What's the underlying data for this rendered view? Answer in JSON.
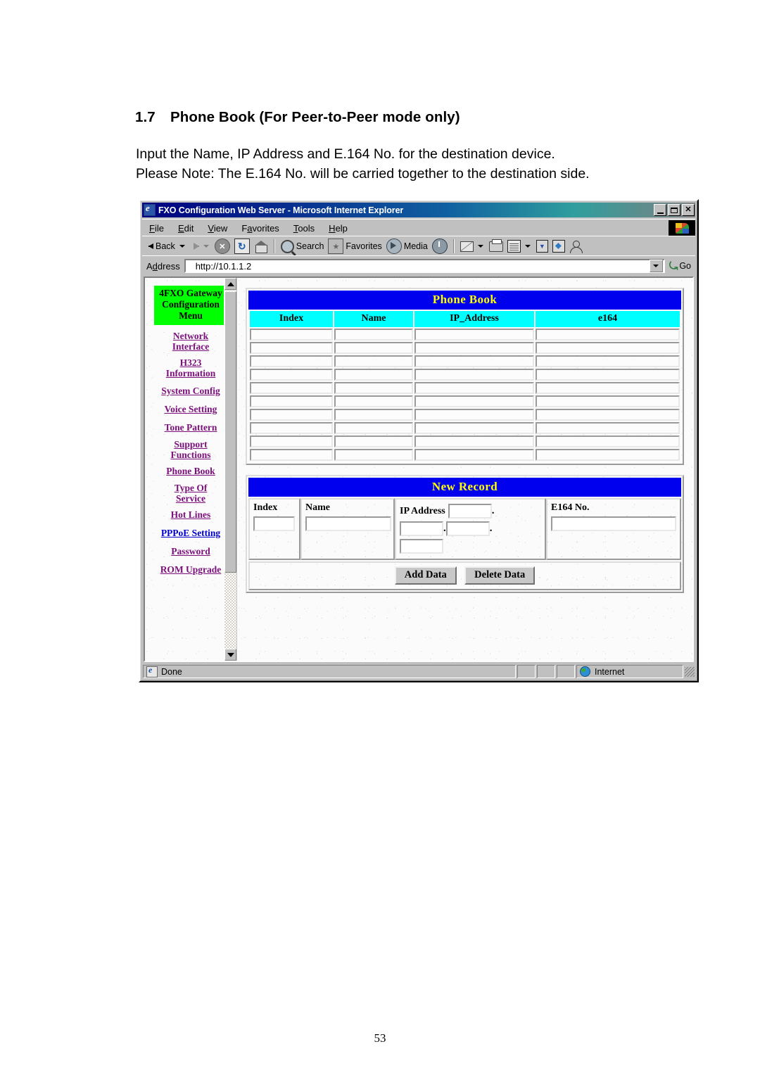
{
  "document": {
    "section_number": "1.7",
    "heading": "Phone Book (For Peer-to-Peer mode only)",
    "paragraph_line1": "Input the Name, IP Address and E.164 No. for the destination device.",
    "paragraph_line2": "Please Note: The E.164 No. will be carried together to the destination side.",
    "page_number": "53"
  },
  "browser": {
    "title": "FXO Configuration Web Server - Microsoft Internet Explorer",
    "window_buttons": {
      "minimize": "_",
      "maximize": "□",
      "close": "✕"
    },
    "menu": [
      {
        "label": "File",
        "accel": "F"
      },
      {
        "label": "Edit",
        "accel": "E"
      },
      {
        "label": "View",
        "accel": "V"
      },
      {
        "label": "Favorites",
        "accel": "a"
      },
      {
        "label": "Tools",
        "accel": "T"
      },
      {
        "label": "Help",
        "accel": "H"
      }
    ],
    "toolbar": {
      "back": "Back",
      "search": "Search",
      "favorites": "Favorites",
      "media": "Media",
      "icons": [
        "back-icon",
        "forward-icon",
        "stop-icon",
        "refresh-icon",
        "home-icon",
        "search-icon",
        "favorites-icon",
        "media-icon",
        "history-icon",
        "mail-icon",
        "print-icon",
        "edit-icon",
        "discuss-icon",
        "messenger-icon",
        "person-icon"
      ]
    },
    "address": {
      "label": "Address",
      "value": "http://10.1.1.2",
      "go_label": "Go"
    },
    "status": {
      "text": "Done",
      "zone": "Internet"
    }
  },
  "sidebar": {
    "header_lines": [
      "4FXO Gateway",
      "Configuration",
      "Menu"
    ],
    "items": [
      {
        "label": "Network Interface",
        "lines": [
          "Network",
          "Interface"
        ],
        "color": "purple"
      },
      {
        "label": "H323 Information",
        "lines": [
          "H323",
          "Information"
        ],
        "color": "purple"
      },
      {
        "label": "System Config",
        "lines": [
          "System Config"
        ],
        "color": "purple"
      },
      {
        "label": "Voice Setting",
        "lines": [
          "Voice Setting"
        ],
        "color": "purple"
      },
      {
        "label": "Tone Pattern",
        "lines": [
          "Tone Pattern"
        ],
        "color": "purple"
      },
      {
        "label": "Support Functions",
        "lines": [
          "Support",
          "Functions"
        ],
        "color": "purple"
      },
      {
        "label": "Phone Book",
        "lines": [
          "Phone Book"
        ],
        "color": "purple"
      },
      {
        "label": "Type Of Service",
        "lines": [
          "Type Of",
          "Service"
        ],
        "color": "purple"
      },
      {
        "label": "Hot Lines",
        "lines": [
          "Hot Lines"
        ],
        "color": "purple"
      },
      {
        "label": "PPPoE Setting",
        "lines": [
          "PPPoE Setting"
        ],
        "color": "blue"
      },
      {
        "label": "Password",
        "lines": [
          "Password"
        ],
        "color": "purple"
      },
      {
        "label": "ROM Upgrade",
        "lines": [
          "ROM Upgrade"
        ],
        "color": "purple"
      }
    ]
  },
  "phone_book": {
    "title": "Phone Book",
    "columns": [
      "Index",
      "Name",
      "IP_Address",
      "e164"
    ],
    "rows": [
      {
        "index": "",
        "name": "",
        "ip_address": "",
        "e164": ""
      },
      {
        "index": "",
        "name": "",
        "ip_address": "",
        "e164": ""
      },
      {
        "index": "",
        "name": "",
        "ip_address": "",
        "e164": ""
      },
      {
        "index": "",
        "name": "",
        "ip_address": "",
        "e164": ""
      },
      {
        "index": "",
        "name": "",
        "ip_address": "",
        "e164": ""
      },
      {
        "index": "",
        "name": "",
        "ip_address": "",
        "e164": ""
      },
      {
        "index": "",
        "name": "",
        "ip_address": "",
        "e164": ""
      },
      {
        "index": "",
        "name": "",
        "ip_address": "",
        "e164": ""
      },
      {
        "index": "",
        "name": "",
        "ip_address": "",
        "e164": ""
      },
      {
        "index": "",
        "name": "",
        "ip_address": "",
        "e164": ""
      }
    ]
  },
  "new_record": {
    "title": "New Record",
    "index_label": "Index",
    "index_value": "",
    "name_label": "Name",
    "name_value": "",
    "ip_label": "IP Address",
    "ip_octets": [
      "",
      "",
      "",
      ""
    ],
    "ip_separator": ".",
    "e164_label": "E164 No.",
    "e164_value": "",
    "add_button": "Add Data",
    "delete_button": "Delete Data"
  },
  "colors": {
    "panel_title_bg": "#0000ee",
    "panel_title_fg": "#ffff00",
    "column_header_bg": "#00ffff",
    "menu_header_bg": "#00ff00",
    "link_purple": "#7b0f7b",
    "link_blue": "#0000cc"
  }
}
